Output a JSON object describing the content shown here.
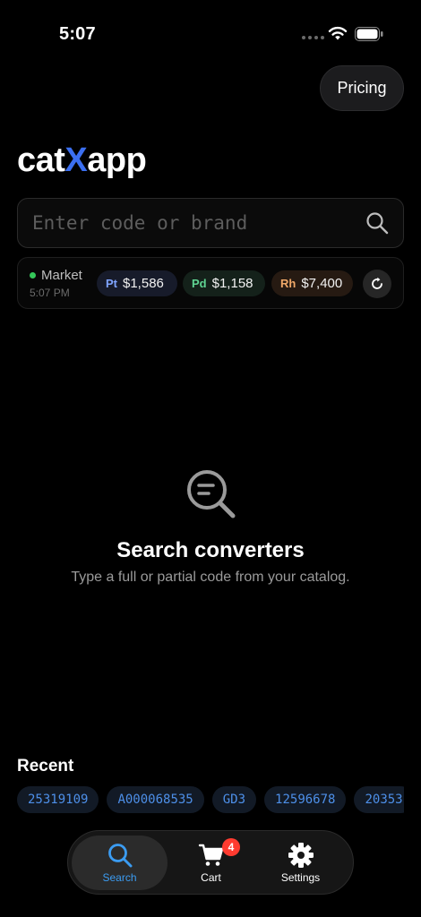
{
  "status_bar": {
    "time": "5:07"
  },
  "header": {
    "pricing_label": "Pricing"
  },
  "logo": {
    "part1": "cat",
    "accent": "X",
    "part2": "app",
    "accent_color": "#3b6ff0"
  },
  "search": {
    "placeholder": "Enter code or brand",
    "value": ""
  },
  "market": {
    "label": "Market",
    "time": "5:07 PM",
    "status_color": "#34c759",
    "metals": [
      {
        "symbol": "Pt",
        "price": "$1,586"
      },
      {
        "symbol": "Pd",
        "price": "$1,158"
      },
      {
        "symbol": "Rh",
        "price": "$7,400"
      }
    ]
  },
  "empty_state": {
    "title": "Search converters",
    "subtitle": "Type a full or partial code from your catalog."
  },
  "recent": {
    "title": "Recent",
    "items": [
      "25319109",
      "A000068535",
      "GD3",
      "12596678",
      "20353"
    ]
  },
  "tab_bar": {
    "active": "Search",
    "active_color": "#3b9cf2",
    "tabs": [
      {
        "label": "Search",
        "icon": "magnifier-icon"
      },
      {
        "label": "Cart",
        "icon": "cart-icon",
        "badge": "4"
      },
      {
        "label": "Settings",
        "icon": "gear-icon"
      }
    ]
  }
}
